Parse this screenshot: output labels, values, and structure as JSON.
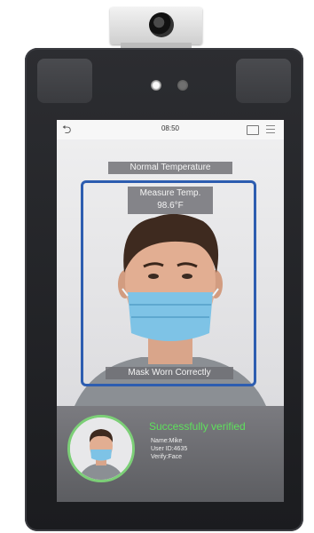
{
  "status_bar": {
    "time": "08:50",
    "back_icon": "back-arrow-icon",
    "card_icon": "id-card-icon",
    "menu_icon": "menu-icon"
  },
  "overlay": {
    "status": "Normal Temperature",
    "measure_label": "Measure Temp.",
    "temperature": "98.6°F",
    "mask_status": "Mask Worn Correctly",
    "frame_color": "#2d5db0"
  },
  "result": {
    "title": "Successfully verified",
    "name": "Name:Mike",
    "user_id": "User ID:4635",
    "verify": "Verify:Face",
    "accent_color": "#5ee15c"
  }
}
